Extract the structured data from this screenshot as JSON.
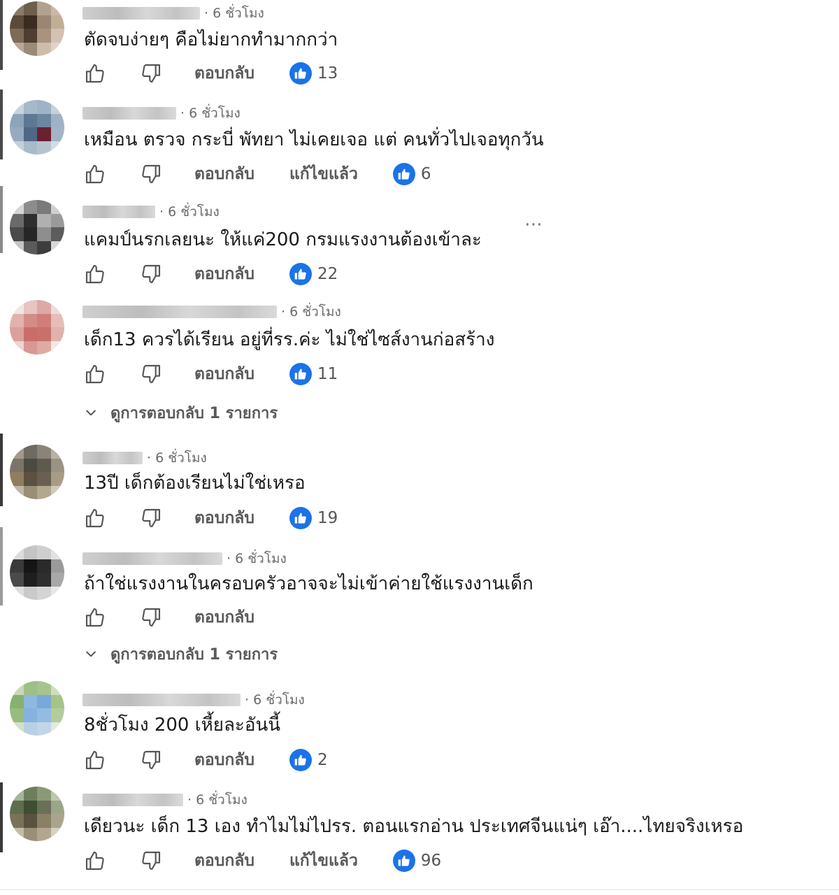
{
  "labels": {
    "reply": "ตอบกลับ",
    "edited": "แก้ไขแล้ว",
    "more": "⋯"
  },
  "colors": {
    "accent": "#1a73e8",
    "action_text": "#5a5a5a",
    "meta_text": "#6b6b6b"
  },
  "icons": {
    "like": "thumbs-up-outline-icon",
    "dislike": "thumbs-down-outline-icon",
    "like_badge": "blue-like-badge-icon",
    "more": "more-options-icon",
    "expand": "chevron-down-icon"
  },
  "comments": [
    {
      "time": "· 6 ชั่วโมง",
      "text": "ตัดจบง่ายๆ คือไม่ยากทำมากกว่า",
      "likes": "13",
      "edited": false
    },
    {
      "time": "· 6 ชั่วโมง",
      "text": "เหมือน ตรวจ กระบี่ พัทยา ไม่เคยเจอ แต่ คนทั่วไปเจอทุกวัน",
      "likes": "6",
      "edited": true
    },
    {
      "time": "· 6 ชั่วโมง",
      "text": "แคมป์นรกเลยนะ ให้แค่200 กรมแรงงานต้องเข้าละ",
      "likes": "22",
      "edited": false
    },
    {
      "time": "· 6 ชั่วโมง",
      "text": "เด็ก13 ควรได้เรียน อยู่ที่รร.ค่ะ ไม่ใช่ไซส์งานก่อสร้าง",
      "likes": "11",
      "edited": false,
      "replies": "ดูการตอบกลับ 1 รายการ"
    },
    {
      "time": "· 6 ชั่วโมง",
      "text": "13ปี เด็กต้องเรียนไม่ใช่เหรอ",
      "likes": "19",
      "edited": false
    },
    {
      "time": "· 6 ชั่วโมง",
      "text": "ถ้าใช่แรงงานในครอบครัวอาจจะไม่เข้าค่ายใช้แรงงานเด็ก",
      "likes": "",
      "edited": false,
      "replies": "ดูการตอบกลับ 1 รายการ"
    },
    {
      "time": "· 6 ชั่วโมง",
      "text": "8ชั่วโมง 200 เหี้ยละอันนี้",
      "likes": "2",
      "edited": false
    },
    {
      "time": "· 6 ชั่วโมง",
      "text": "เดียวนะ เด็ก 13 เอง ทำไมไม่ไปรร. ตอนแรกอ่าน ประเทศจีนแน่ๆ เอ๊า....ไทยจริงเหรอ",
      "likes": "96",
      "edited": true
    }
  ]
}
